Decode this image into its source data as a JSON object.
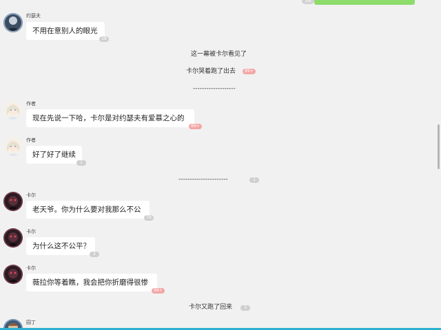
{
  "top_message": {
    "count": "54"
  },
  "messages": [
    {
      "user": "约瑟夫",
      "text": "不用在意别人的眼光",
      "count": "18",
      "avatar": "joseph-avatar"
    },
    {
      "user": "作者",
      "text": "现在先说一下哈，卡尔是对约瑟夫有爱慕之心的",
      "count": "99+",
      "avatar": "author-avatar"
    },
    {
      "user": "作者",
      "text": "好了好了继续",
      "count": "1",
      "avatar": "author-avatar"
    },
    {
      "user": "卡尔",
      "text": "老天爷。你为什么要对我那么不公",
      "count": "79",
      "avatar": "karl-avatar"
    },
    {
      "user": "卡尔",
      "text": "为什么这不公平？",
      "count": "2",
      "avatar": "karl-avatar"
    },
    {
      "user": "卡尔",
      "text": "薇拉你等着瞧，我会把你折磨得很惨",
      "count": "99+",
      "avatar": "karl-avatar"
    },
    {
      "user": "园丁",
      "avatar": "gardener-avatar"
    }
  ],
  "narrations": [
    {
      "text": "这一幕被卡尔看见了"
    },
    {
      "text": "卡尔哭着跑了出去",
      "count": "99+"
    },
    {
      "text": "-------------------"
    },
    {
      "text": "----------------------",
      "count": "1"
    },
    {
      "text": "卡尔又跑了回来",
      "count": "3"
    }
  ],
  "colors": {
    "background": "#f1f1f1",
    "bubble": "#ffffff",
    "own_bubble": "#8ddc6c",
    "count_gray": "#cfcfcf",
    "count_pink": "#f4a6a6",
    "bottom_bar": "#2bb1cf"
  }
}
